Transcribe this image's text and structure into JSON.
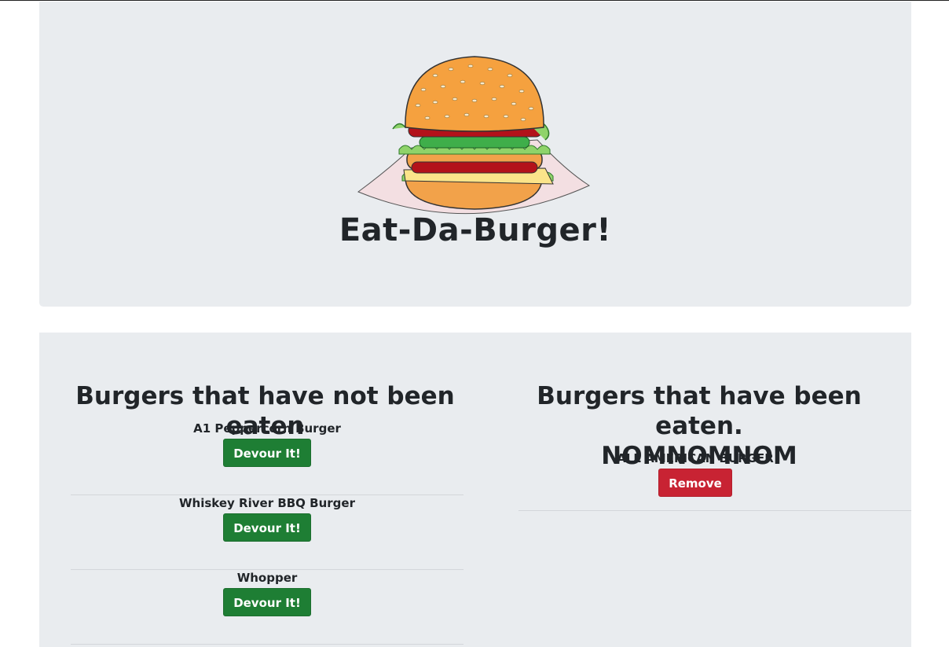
{
  "header": {
    "title": "Eat-Da-Burger!",
    "logo": "burger-illustration"
  },
  "not_eaten": {
    "heading": "Burgers that have not been eaten",
    "button_label": "Devour It!",
    "items": [
      {
        "name": "A1 Peppercorn Burger"
      },
      {
        "name": "Whiskey River BBQ Burger"
      },
      {
        "name": "Whopper"
      }
    ]
  },
  "eaten": {
    "heading_line1": "Burgers that have been eaten.",
    "heading_line2": "NOMNOMNOM",
    "button_label": "Remove",
    "items": [
      {
        "name": "ALL AMERICAN BURGER"
      }
    ]
  },
  "colors": {
    "panel_bg": "#e9ecef",
    "devour_button": "#1e7e34",
    "remove_button": "#c82333",
    "text": "#212529"
  }
}
